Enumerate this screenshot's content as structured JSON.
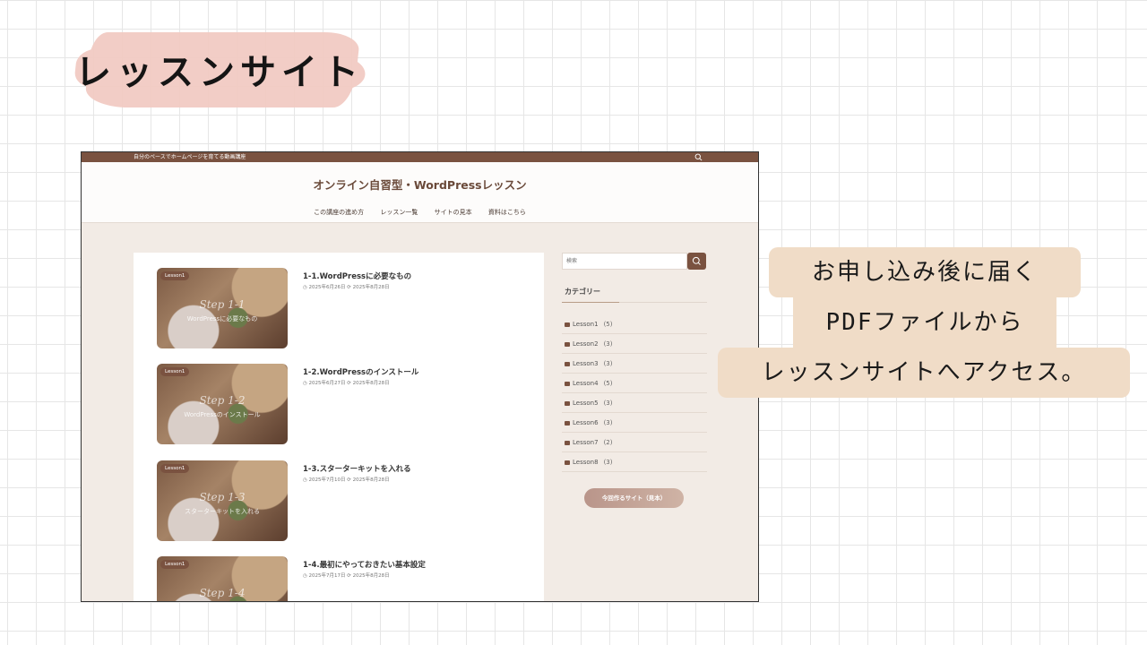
{
  "slide": {
    "title": "レッスンサイト"
  },
  "site": {
    "tagline": "自分のペースでホームページを育てる動画講座",
    "title": "オンライン自習型・WordPressレッスン",
    "nav": [
      "この講座の進め方",
      "レッスン一覧",
      "サイトの見本",
      "資料はこちら"
    ]
  },
  "posts": [
    {
      "badge": "Lesson1",
      "step": "Step 1-1",
      "thumb_text": "WordPressに必要なもの",
      "title": "1-1.WordPressに必要なもの",
      "meta": "◷ 2025年6月26日  ⟳ 2025年8月28日"
    },
    {
      "badge": "Lesson1",
      "step": "Step 1-2",
      "thumb_text": "WordPressのインストール",
      "title": "1-2.WordPressのインストール",
      "meta": "◷ 2025年6月27日  ⟳ 2025年8月28日"
    },
    {
      "badge": "Lesson1",
      "step": "Step 1-3",
      "thumb_text": "スターターキットを入れる",
      "title": "1-3.スターターキットを入れる",
      "meta": "◷ 2025年7月10日  ⟳ 2025年8月28日"
    },
    {
      "badge": "Lesson1",
      "step": "Step 1-4",
      "thumb_text": "",
      "title": "1-4.最初にやっておきたい基本設定",
      "meta": "◷ 2025年7月17日  ⟳ 2025年8月28日"
    }
  ],
  "sidebar": {
    "search_placeholder": "検索",
    "categories_heading": "カテゴリー",
    "categories": [
      {
        "name": "Lesson1",
        "count": "(5)"
      },
      {
        "name": "Lesson2",
        "count": "(3)"
      },
      {
        "name": "Lesson3",
        "count": "(3)"
      },
      {
        "name": "Lesson4",
        "count": "(5)"
      },
      {
        "name": "Lesson5",
        "count": "(3)"
      },
      {
        "name": "Lesson6",
        "count": "(3)"
      },
      {
        "name": "Lesson7",
        "count": "(2)"
      },
      {
        "name": "Lesson8",
        "count": "(3)"
      }
    ],
    "cta": "今回作るサイト（見本）"
  },
  "callout": {
    "lines": [
      "お申し込み後に届く",
      "PDFファイルから",
      "レッスンサイトへアクセス。"
    ]
  },
  "colors": {
    "accent_brown": "#7a5240",
    "highlight_pink": "#f2cbc3",
    "callout_beige": "#f0dcc7"
  }
}
